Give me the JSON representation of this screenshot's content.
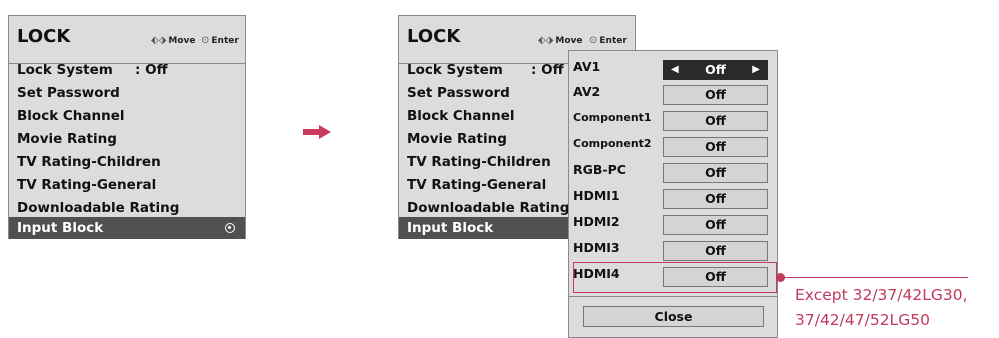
{
  "menu": {
    "title": "LOCK",
    "hint_move": "Move",
    "hint_enter": "Enter",
    "items": [
      {
        "label": "Lock System",
        "value": ": Off"
      },
      {
        "label": "Set Password"
      },
      {
        "label": "Block Channel"
      },
      {
        "label": "Movie Rating"
      },
      {
        "label": "TV Rating-Children"
      },
      {
        "label": "TV Rating-General"
      },
      {
        "label": "Downloadable Rating"
      },
      {
        "label": "Input Block"
      }
    ],
    "selected_item": "Input Block"
  },
  "input_block": {
    "rows": [
      {
        "label": "AV1",
        "value": "Off"
      },
      {
        "label": "AV2",
        "value": "Off"
      },
      {
        "label": "Component1",
        "value": "Off"
      },
      {
        "label": "Component2",
        "value": "Off"
      },
      {
        "label": "RGB-PC",
        "value": "Off"
      },
      {
        "label": "HDMI1",
        "value": "Off"
      },
      {
        "label": "HDMI2",
        "value": "Off"
      },
      {
        "label": "HDMI3",
        "value": "Off"
      },
      {
        "label": "HDMI4",
        "value": "Off"
      }
    ],
    "close_label": "Close"
  },
  "note": {
    "line1": "Except 32/37/42LG30,",
    "line2": "37/42/47/52LG50"
  },
  "colors": {
    "menu_bg": "#dcdcdc",
    "selected_bg": "#505050",
    "accent": "#c03a5c",
    "arrow": "#c93a5f"
  }
}
